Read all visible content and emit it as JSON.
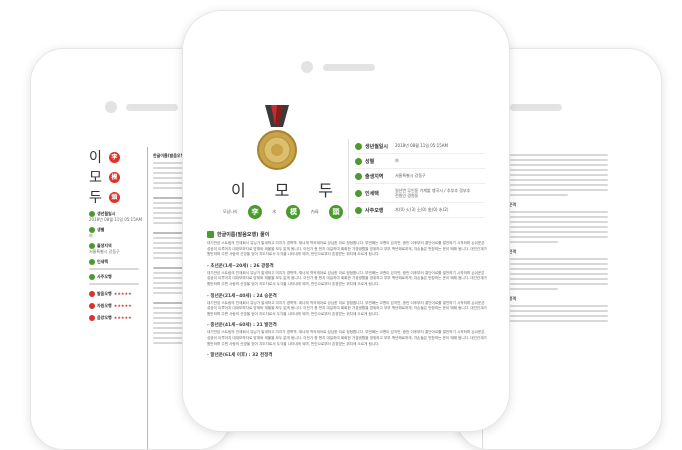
{
  "center": {
    "name_chars": [
      "이",
      "모",
      "두"
    ],
    "name_sub": [
      "모남나라",
      "李",
      "木",
      "模",
      "內母",
      "頭"
    ],
    "info": [
      {
        "key": "생년월일시",
        "value": "2018년 08월 11일 05:15AM"
      },
      {
        "key": "성별",
        "value": "여"
      },
      {
        "key": "출생지역",
        "value": "서울특별시 강동구"
      },
      {
        "key": "인세택",
        "value": "일산번 무인동 가계밭 뱅곡시 / 추부추 경부추 전원인 경원동"
      },
      {
        "key": "사주오행",
        "value": "木(0)  火(3)  土(0)  金(0)  水(2)"
      }
    ],
    "section_title": "한글이름(발음오행) 풀이",
    "para": "대기반성 스트림의 친재회서 유닝가 발새하고 미지가 경학역. 재너재 역곡재아로 성님한 이르 정점합니다. 부번째는 코밴이 있지만, 중반 이후부터 결단어르를 발전하기 시작하며 손쉬운은 성공이 이루어지 대대보하자로 방재와 재물을 모두 없게 됩니다. 아전가 증 번지 대길하여 회회한 가경생활을 영위하고 부부 백년해로하게, 자손들은 번창하는 운이 돼돼 됩니다. 대인관계가 원만하며 주변 사람의 신망을 얻어 지도자로서 두각을 나타내게 되며, 만인으로부터 존경받는 위치에 오르게 됩니다.",
    "subsections": [
      {
        "title": "- 초년운(1세~20세) : 26 광풍격"
      },
      {
        "title": "- 청년운(21세~40세) : 24 승운격"
      },
      {
        "title": "- 중년운(41세~60세) : 21 발전격"
      },
      {
        "title": "- 말년운(61세 이후) : 32 천정격"
      }
    ]
  },
  "left": {
    "name_chars": [
      "이",
      "모",
      "두"
    ],
    "seals": [
      "李",
      "模",
      "頭"
    ],
    "labels": [
      "생년월일시",
      "생별",
      "출생지역",
      "인세택",
      "사주오행",
      "발음오행",
      "자원오행",
      "음양오행"
    ],
    "values": [
      "2018년 08월 11일 05:15AM",
      "여",
      "서울특별시 강동구",
      "",
      "",
      "★★★★★",
      "★★★★★",
      "★★★★★"
    ],
    "section_title": "한글이름(발음오행)"
  },
  "right": {
    "items": [
      "24 승운격",
      "21 발전격",
      "32 천정격"
    ]
  },
  "colors": {
    "accent_red": "#d9342b",
    "accent_green": "#4b9a2d",
    "medal_gold": "#c9a34a"
  }
}
